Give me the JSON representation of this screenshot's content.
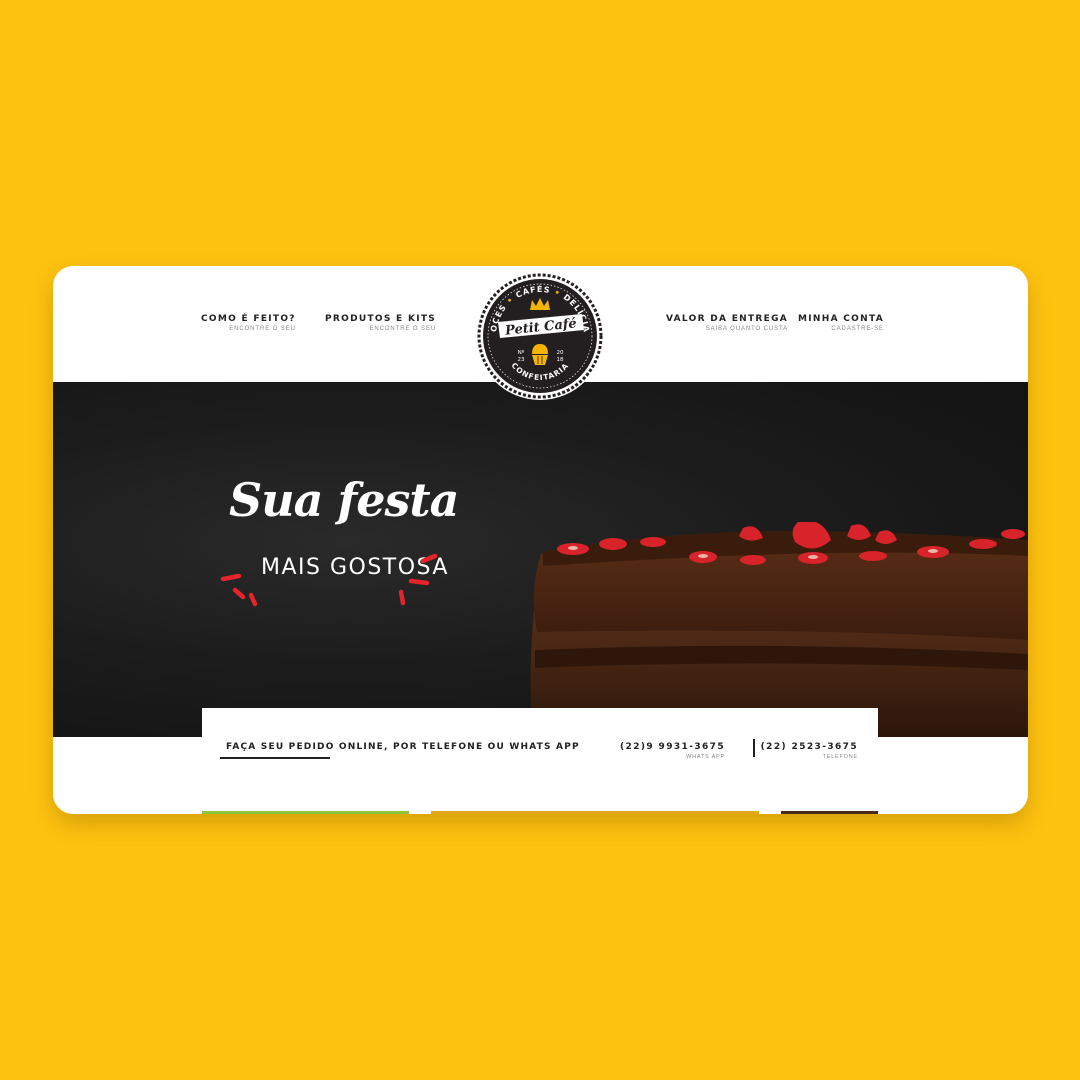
{
  "colors": {
    "page_background": "#FDC20F",
    "hero_background": "#1c1c1c",
    "logo_accent": "#F5B400",
    "sprinkle_red": "#E5232B",
    "strip_green": "#8CC63F",
    "strip_gold": "#E0A91B",
    "strip_brown": "#4A2A1A"
  },
  "nav": {
    "left": [
      {
        "label": "COMO É FEITO?",
        "sub": "ENCONTRE O SEU"
      },
      {
        "label": "PRODUTOS E KITS",
        "sub": "ENCONTRE O SEU"
      }
    ],
    "right": [
      {
        "label": "VALOR DA ENTREGA",
        "sub": "SAIBA QUANTO CUSTA"
      },
      {
        "label": "MINHA CONTA",
        "sub": "CADASTRE-SE"
      }
    ]
  },
  "logo": {
    "top_words": [
      "DOCES",
      "CAFÉS",
      "DELÍCIAS"
    ],
    "name": "Petit Café",
    "left_badge": [
      "Nº",
      "23"
    ],
    "right_badge": [
      "20",
      "18"
    ],
    "bottom_word": "CONFEITARIA",
    "icons": [
      "crown-icon",
      "cupcake-icon"
    ]
  },
  "hero": {
    "title": "Sua festa",
    "subtitle": "MAIS GOSTOSA"
  },
  "order_bar": {
    "text": "FAÇA SEU PEDIDO ONLINE, POR TELEFONE OU WHATS APP",
    "phones": [
      {
        "number": "(22)9 9931-3675",
        "label": "WHATS APP"
      },
      {
        "number": "(22) 2523-3675",
        "label": "TELEFONE"
      }
    ]
  }
}
